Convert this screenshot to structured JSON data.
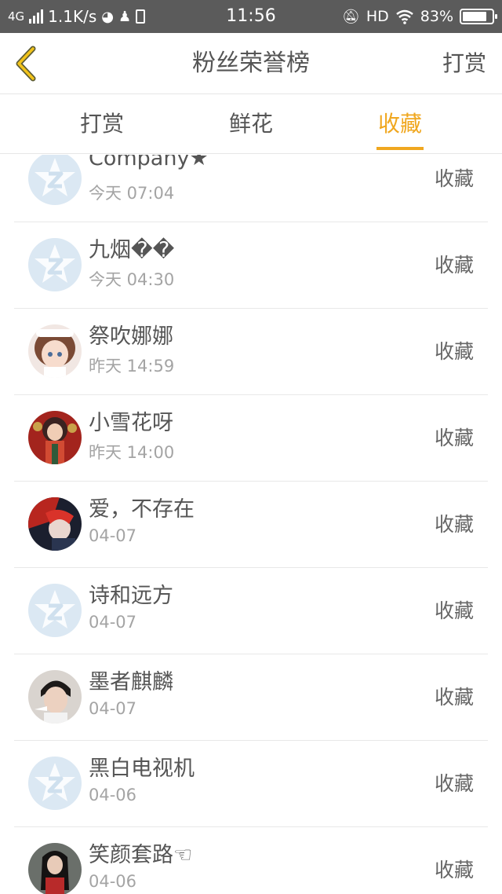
{
  "status_bar": {
    "network": "4G",
    "speed": "1.1K/s",
    "time": "11:56",
    "hd": "HD",
    "battery": "83%",
    "battery_level": 0.83
  },
  "header": {
    "title": "粉丝荣誉榜",
    "right_action": "打赏"
  },
  "tabs": [
    {
      "label": "打赏",
      "active": false
    },
    {
      "label": "鲜花",
      "active": false
    },
    {
      "label": "收藏",
      "active": true
    }
  ],
  "entries": [
    {
      "name": "Company★",
      "time": "今天 07:04",
      "action": "收藏",
      "avatar": "default"
    },
    {
      "name": "九烟��",
      "time": "今天 04:30",
      "action": "收藏",
      "avatar": "default"
    },
    {
      "name": "祭吹娜娜",
      "time": "昨天 14:59",
      "action": "收藏",
      "avatar": "anime-girl"
    },
    {
      "name": "小雪花呀",
      "time": "昨天 14:00",
      "action": "收藏",
      "avatar": "red-costume"
    },
    {
      "name": "爱，不存在",
      "time": "04-07",
      "action": "收藏",
      "avatar": "red-hair"
    },
    {
      "name": "诗和远方",
      "time": "04-07",
      "action": "收藏",
      "avatar": "default"
    },
    {
      "name": "墨者麒麟",
      "time": "04-07",
      "action": "收藏",
      "avatar": "young-man"
    },
    {
      "name": "黑白电视机",
      "time": "04-06",
      "action": "收藏",
      "avatar": "default"
    },
    {
      "name": "笑颜套路☜",
      "time": "04-06",
      "action": "收藏",
      "avatar": "woman-portrait"
    }
  ]
}
